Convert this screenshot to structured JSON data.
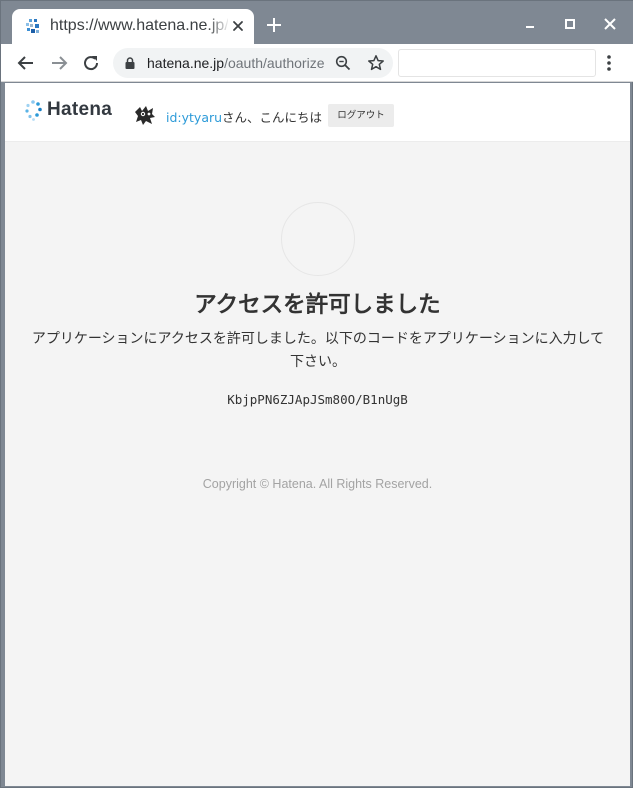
{
  "browser": {
    "tab_title": "https://www.hatena.ne.jp/oauth/authorize",
    "url_host": "hatena.ne.jp",
    "url_path": "/oauth/authorize"
  },
  "site": {
    "logo_text": "Hatena",
    "user_id": "id:ytyaru",
    "greeting_suffix": "さん、こんにちは",
    "logout_label": "ログアウト"
  },
  "main": {
    "title": "アクセスを許可しました",
    "description": "アプリケーションにアクセスを許可しました。以下のコードをアプリケーションに入力して下さい。",
    "code": "KbjpPN6ZJApJSm80O/B1nUgB",
    "copyright": "Copyright © Hatena. All Rights Reserved."
  },
  "colors": {
    "brand_blue": "#2c9ad8",
    "page_bg": "#f4f4f4",
    "chrome_frame": "#7f8893"
  },
  "icons": {
    "tab_favicon": "hatena-favicon-icon",
    "tab_close": "close-icon",
    "new_tab": "plus-icon",
    "back": "arrow-left-icon",
    "forward": "arrow-right-icon",
    "reload": "reload-icon",
    "lock": "lock-icon",
    "zoom": "zoom-out-icon",
    "bookmark": "star-icon",
    "menu": "kebab-menu-icon"
  }
}
